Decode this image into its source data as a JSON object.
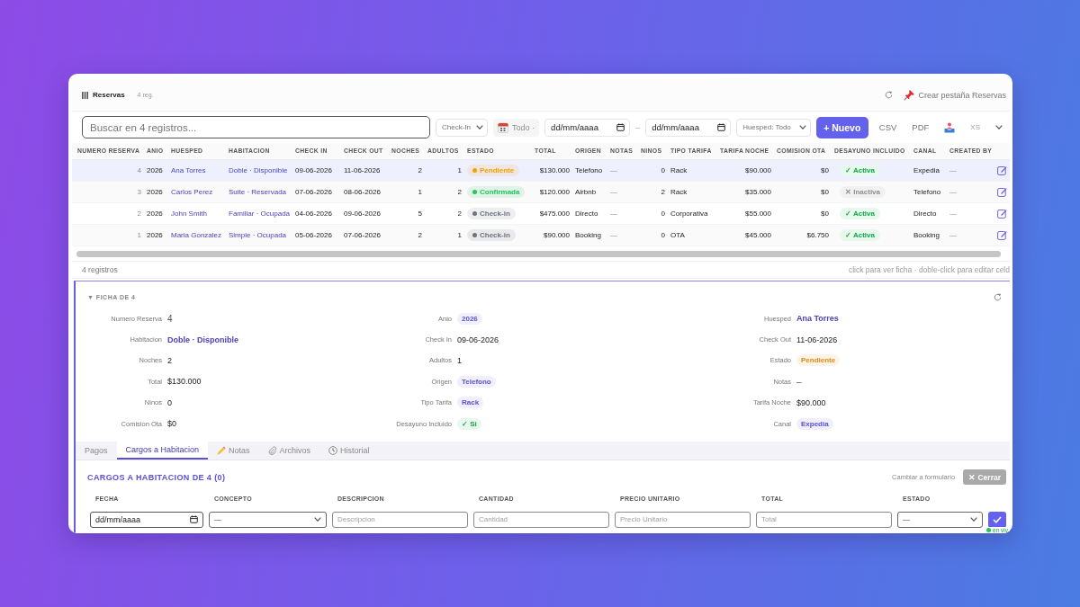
{
  "header": {
    "title": "Reservas",
    "count": "4 reg.",
    "pin_label": "Crear pestaña Reservas"
  },
  "toolbar": {
    "search": {
      "placeholder": "Buscar en 4 registros..."
    },
    "date_column": {
      "value": "Check-In"
    },
    "period": {
      "value": "Todo ·"
    },
    "date_from": {
      "placeholder": "dd/mm/aaaa"
    },
    "separator": "–",
    "date_to": {
      "placeholder": "dd/mm/aaaa"
    },
    "guest": {
      "value": "Huesped: Todo"
    },
    "actions": [
      {
        "kind": "primary",
        "label": "+ Nuevo"
      },
      {
        "kind": "plain",
        "label": "CSV"
      },
      {
        "kind": "plain",
        "label": "PDF"
      },
      {
        "kind": "icon"
      },
      {
        "kind": "muted",
        "label": "XS"
      },
      {
        "kind": "menu"
      }
    ]
  },
  "table": {
    "columns": [
      {
        "label": "NUMERO RESERVA",
        "kind": "id"
      },
      {
        "label": "ANIO",
        "kind": "text"
      },
      {
        "label": "HUESPED",
        "kind": "link"
      },
      {
        "label": "HABITACION",
        "kind": "link"
      },
      {
        "label": "CHECK IN",
        "kind": "text"
      },
      {
        "label": "CHECK OUT",
        "kind": "text"
      },
      {
        "label": "NOCHES",
        "kind": "num"
      },
      {
        "label": "ADULTOS",
        "kind": "num"
      },
      {
        "label": "ESTADO",
        "kind": "status"
      },
      {
        "label": "TOTAL",
        "kind": "num"
      },
      {
        "label": "ORIGEN",
        "kind": "text"
      },
      {
        "label": "NOTAS",
        "kind": "muted"
      },
      {
        "label": "NINOS",
        "kind": "num"
      },
      {
        "label": "TIPO TARIFA",
        "kind": "text"
      },
      {
        "label": "TARIFA NOCHE",
        "kind": "num"
      },
      {
        "label": "COMISION OTA",
        "kind": "num"
      },
      {
        "label": "DESAYUNO INCLUIDO",
        "kind": "flag"
      },
      {
        "label": "CANAL",
        "kind": "text"
      },
      {
        "label": "CREATED BY",
        "kind": "muted"
      }
    ],
    "rows": [
      {
        "selected": true,
        "cells": [
          "4",
          "2026",
          "Ana Torres",
          "Doble · Disponible",
          "09-06-2026",
          "11-06-2026",
          "2",
          "1",
          {
            "text": "Pendiente",
            "color": "#f59e0b"
          },
          "$130.000",
          "Telefono",
          "—",
          "0",
          "Rack",
          "$90.000",
          "$0",
          {
            "text": "✓ Activa",
            "on": true
          },
          "Expedia",
          "—"
        ]
      },
      {
        "selected": false,
        "cells": [
          "3",
          "2026",
          "Carlos Perez",
          "Suite · Reservada",
          "07-06-2026",
          "08-06-2026",
          "1",
          "2",
          {
            "text": "Confirmada",
            "color": "#22c55e"
          },
          "$120.000",
          "Airbnb",
          "—",
          "2",
          "Rack",
          "$35.000",
          "$0",
          {
            "text": "✕ Inactiva",
            "on": false
          },
          "Telefono",
          "—"
        ]
      },
      {
        "selected": false,
        "cells": [
          "2",
          "2026",
          "John Smith",
          "Familiar · Ocupada",
          "04-06-2026",
          "09-06-2026",
          "5",
          "2",
          {
            "text": "Check-in",
            "color": "#6b7280"
          },
          "$475.000",
          "Directo",
          "—",
          "0",
          "Corporativa",
          "$55.000",
          "$0",
          {
            "text": "✓ Activa",
            "on": true
          },
          "Directo",
          "—"
        ]
      },
      {
        "selected": false,
        "cells": [
          "1",
          "2026",
          "Maria Gonzalez",
          "Simple · Ocupada",
          "05-06-2026",
          "07-06-2026",
          "2",
          "1",
          {
            "text": "Check-in",
            "color": "#6b7280"
          },
          "$90.000",
          "Booking",
          "—",
          "0",
          "OTA",
          "$45.000",
          "$6.750",
          {
            "text": "✓ Activa",
            "on": true
          },
          "Booking",
          "—"
        ]
      }
    ],
    "footer": {
      "count": "4 registros",
      "hint": "click para ver ficha · doble-click para editar celd"
    }
  },
  "detail": {
    "title": "▼ FICHA DE 4",
    "fields": [
      {
        "label": "Numero Reserva",
        "value": "4",
        "kind": "muted"
      },
      {
        "label": "Anio",
        "value": "2026",
        "kind": "tag",
        "color": "#5b50d6"
      },
      {
        "label": "Huesped",
        "value": "Ana Torres",
        "kind": "link"
      },
      {
        "label": "Habitacion",
        "value": "Doble · Disponible",
        "kind": "link"
      },
      {
        "label": "Check In",
        "value": "09-06-2026",
        "kind": "text"
      },
      {
        "label": "Check Out",
        "value": "11-06-2026",
        "kind": "text"
      },
      {
        "label": "Noches",
        "value": "2",
        "kind": "text"
      },
      {
        "label": "Adultos",
        "value": "1",
        "kind": "text"
      },
      {
        "label": "Estado",
        "value": "Pendiente",
        "kind": "tag",
        "color": "#e8870e"
      },
      {
        "label": "Total",
        "value": "$130.000",
        "kind": "text"
      },
      {
        "label": "Origen",
        "value": "Telefono",
        "kind": "tag",
        "color": "#5b50d6"
      },
      {
        "label": "Notas",
        "value": "–",
        "kind": "muted"
      },
      {
        "label": "Ninos",
        "value": "0",
        "kind": "text"
      },
      {
        "label": "Tipo Tarifa",
        "value": "Rack",
        "kind": "tag",
        "color": "#5b50d6"
      },
      {
        "label": "Tarifa Noche",
        "value": "$90.000",
        "kind": "text"
      },
      {
        "label": "Comision Ota",
        "value": "$0",
        "kind": "text"
      },
      {
        "label": "Desayuno Incluido",
        "value": "✓ Si",
        "kind": "tag",
        "color": "#16a34a"
      },
      {
        "label": "Canal",
        "value": "Expedia",
        "kind": "tag",
        "color": "#5b50d6"
      }
    ]
  },
  "tabs": [
    {
      "label": "Pagos",
      "selected": false
    },
    {
      "label": "Cargos a Habitacion",
      "selected": true
    },
    {
      "label": "Notas",
      "selected": false
    },
    {
      "label": "Archivos",
      "selected": false
    },
    {
      "label": "Historial",
      "selected": false
    }
  ],
  "charges": {
    "title": "CARGOS A HABITACION DE 4 (0)",
    "switch_label": "Cambiar a formulario",
    "close_label": "✕ Cerrar",
    "columns": [
      "FECHA",
      "CONCEPTO",
      "DESCRIPCION",
      "CANTIDAD",
      "PRECIO UNITARIO",
      "TOTAL",
      "ESTADO"
    ],
    "inputs": [
      {
        "kind": "date",
        "placeholder": "dd/mm/aaaa"
      },
      {
        "kind": "select",
        "value": "—"
      },
      {
        "kind": "text",
        "placeholder": "Descripcion"
      },
      {
        "kind": "text",
        "placeholder": "Cantidad"
      },
      {
        "kind": "text",
        "placeholder": "Precio Unitario"
      },
      {
        "kind": "text",
        "placeholder": "Total"
      },
      {
        "kind": "select",
        "value": "—"
      }
    ],
    "live_label": "en viv"
  }
}
